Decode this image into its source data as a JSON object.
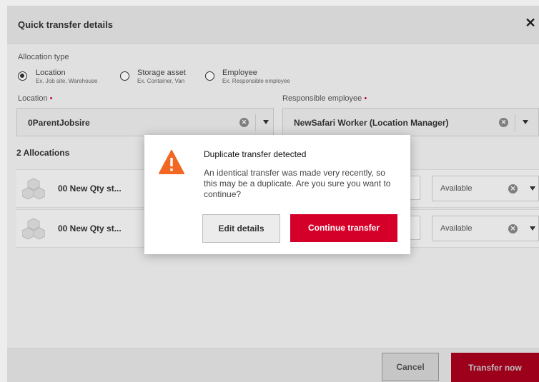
{
  "header": {
    "title": "Quick transfer details",
    "close": "✕"
  },
  "allocation_type": {
    "label": "Allocation type",
    "options": [
      {
        "label": "Location",
        "sub": "Ex. Job site, Warehouse",
        "selected": true
      },
      {
        "label": "Storage asset",
        "sub": "Ex. Container, Van",
        "selected": false
      },
      {
        "label": "Employee",
        "sub": "Ex. Responsible employee",
        "selected": false
      }
    ]
  },
  "location": {
    "label": "Location",
    "required_mark": "•",
    "value": "0ParentJobsire"
  },
  "responsible_employee": {
    "label": "Responsible employee",
    "required_mark": "•",
    "value": "NewSafari Worker (Location Manager)"
  },
  "allocations": {
    "title": "2 Allocations",
    "rows": [
      {
        "name": "00 New Qty st...",
        "status": "Available"
      },
      {
        "name": "00 New Qty st...",
        "status": "Available"
      }
    ]
  },
  "footer": {
    "cancel_label": "Cancel",
    "transfer_label": "Transfer now"
  },
  "dialog": {
    "title": "Duplicate transfer detected",
    "message": "An identical transfer was made very recently, so this may be a duplicate. Are you sure you want to continue?",
    "edit_label": "Edit details",
    "continue_label": "Continue transfer"
  },
  "colors": {
    "primary": "#d50029",
    "warning": "#f26722"
  }
}
